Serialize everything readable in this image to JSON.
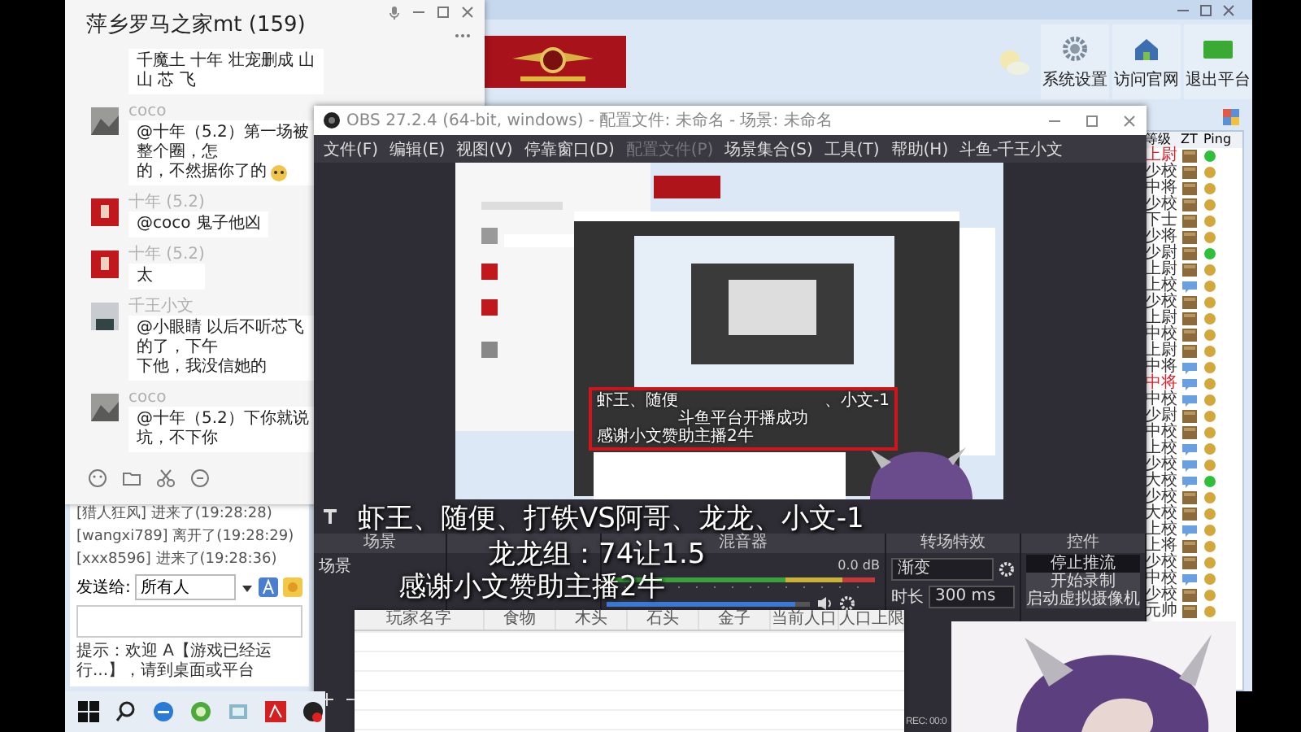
{
  "platform": {
    "toolbar": [
      {
        "kind": "gear",
        "label": "系统设置"
      },
      {
        "kind": "house",
        "label": "访问官网"
      },
      {
        "kind": "exit",
        "label": "退出平台"
      }
    ],
    "system_messages": [
      "[猎人狂风] 进来了(19:28:28)",
      "[wangxi789] 离开了(19:28:29)",
      "[xxx8596] 进来了(19:28:36)"
    ],
    "send_to": {
      "label": "发送给:",
      "value": "所有人"
    },
    "notice": "提示：欢迎 A【游戏已经运行...】，请到桌面或平台",
    "player_list": {
      "columns": [
        "等级",
        "ZT",
        "Ping"
      ],
      "rows": [
        {
          "rank": "上尉",
          "highlight": true,
          "kind": "box",
          "color": "#2fbf3a"
        },
        {
          "rank": "少校",
          "highlight": false,
          "kind": "box",
          "color": "#d4a73a"
        },
        {
          "rank": "中将",
          "highlight": false,
          "kind": "box",
          "color": "#d4a73a"
        },
        {
          "rank": "少校",
          "highlight": false,
          "kind": "box",
          "color": "#d4a73a"
        },
        {
          "rank": "下士",
          "highlight": false,
          "kind": "box",
          "color": "#d4a73a"
        },
        {
          "rank": "少将",
          "highlight": false,
          "kind": "box",
          "color": "#d4a73a"
        },
        {
          "rank": "少尉",
          "highlight": false,
          "kind": "box",
          "color": "#2fbf3a"
        },
        {
          "rank": "上尉",
          "highlight": false,
          "kind": "box",
          "color": "#d4a73a"
        },
        {
          "rank": "上校",
          "highlight": false,
          "kind": "chat",
          "color": "#d4a73a"
        },
        {
          "rank": "少校",
          "highlight": false,
          "kind": "box",
          "color": "#d4a73a"
        },
        {
          "rank": "上尉",
          "highlight": false,
          "kind": "box",
          "color": "#d4a73a"
        },
        {
          "rank": "中校",
          "highlight": false,
          "kind": "box",
          "color": "#d4a73a"
        },
        {
          "rank": "上尉",
          "highlight": false,
          "kind": "box",
          "color": "#d4a73a"
        },
        {
          "rank": "中将",
          "highlight": false,
          "kind": "chat",
          "color": "#d4a73a"
        },
        {
          "rank": "中将",
          "highlight": true,
          "kind": "chat",
          "color": "#d4a73a"
        },
        {
          "rank": "中校",
          "highlight": false,
          "kind": "chat",
          "color": "#d4a73a"
        },
        {
          "rank": "少尉",
          "highlight": false,
          "kind": "box",
          "color": "#d4a73a"
        },
        {
          "rank": "中校",
          "highlight": false,
          "kind": "box",
          "color": "#d4a73a"
        },
        {
          "rank": "上校",
          "highlight": false,
          "kind": "chat",
          "color": "#d4a73a"
        },
        {
          "rank": "少校",
          "highlight": false,
          "kind": "chat",
          "color": "#d4a73a"
        },
        {
          "rank": "大校",
          "highlight": false,
          "kind": "chat",
          "color": "#2fbf3a"
        },
        {
          "rank": "少校",
          "highlight": false,
          "kind": "box",
          "color": "#d4a73a"
        },
        {
          "rank": "大校",
          "highlight": false,
          "kind": "box",
          "color": "#d4a73a"
        },
        {
          "rank": "上校",
          "highlight": false,
          "kind": "chat",
          "color": "#d4a73a"
        },
        {
          "rank": "上将",
          "highlight": false,
          "kind": "box",
          "color": "#d4a73a"
        },
        {
          "rank": "少校",
          "highlight": false,
          "kind": "box",
          "color": "#d4a73a"
        },
        {
          "rank": "中校",
          "highlight": false,
          "kind": "chat",
          "color": "#d4a73a"
        },
        {
          "rank": "少校",
          "highlight": false,
          "kind": "box",
          "color": "#d4a73a"
        },
        {
          "rank": "元帅",
          "highlight": false,
          "kind": "box",
          "color": "#d4a73a"
        }
      ]
    }
  },
  "chat": {
    "title": "萍乡罗马之家mt (159)",
    "messages": [
      {
        "lines": [
          "千魔土 十年 壮宠删成 山山 芯 飞"
        ],
        "emoji": false
      },
      {
        "kind": "landscape",
        "sender": "coco",
        "lines": [
          "@十年（5.2）第一场被整个圈，怎",
          "的，不然据你了的"
        ],
        "emoji": true
      },
      {
        "kind": "red",
        "sender": "十年 (5.2)",
        "lines": [
          "@coco 鬼子他凶"
        ],
        "emoji": false
      },
      {
        "kind": "red",
        "sender": "十年 (5.2)",
        "lines": [
          "太"
        ],
        "emoji": false
      },
      {
        "kind": "person",
        "sender": "千王小文",
        "lines": [
          "@小眼睛 以后不听芯飞的了，下午",
          "下他，我没信她的"
        ],
        "emoji": false
      },
      {
        "kind": "landscape",
        "sender": "coco",
        "lines": [
          "@十年（5.2）下你就说坑，不下你"
        ],
        "emoji": false
      }
    ]
  },
  "obs": {
    "title": "OBS 27.2.4 (64-bit, windows) - 配置文件: 未命名 - 场景: 未命名",
    "menu": [
      {
        "label": "文件(F)",
        "disabled": false
      },
      {
        "label": "编辑(E)",
        "disabled": false
      },
      {
        "label": "视图(V)",
        "disabled": false
      },
      {
        "label": "停靠窗口(D)",
        "disabled": false
      },
      {
        "label": "配置文件(P)",
        "disabled": true
      },
      {
        "label": "场景集合(S)",
        "disabled": false
      },
      {
        "label": "工具(T)",
        "disabled": false
      },
      {
        "label": "帮助(H)",
        "disabled": false
      },
      {
        "label": "斗鱼-千王小文",
        "disabled": false
      }
    ],
    "capture_texts": [
      "虾王、随便",
      "、小文-1",
      "斗鱼平台开播成功",
      "感谢小文赞助主播2牛"
    ],
    "captions": [
      "虾王、随便、打铁VS阿哥、龙龙、小文-1",
      "龙龙组：74让1.5",
      "感谢小文赞助主播2牛"
    ],
    "scenes": {
      "title": "场景",
      "items": [
        "场景"
      ]
    },
    "mixer": {
      "title": "混音器",
      "reading": "0.0 dB",
      "level": 0.93
    },
    "transitions": {
      "title": "转场特效",
      "value": "渐变",
      "duration_label": "时长",
      "duration": "300 ms"
    },
    "controls": {
      "title": "控件",
      "buttons": [
        {
          "label": "停止推流",
          "active": true
        },
        {
          "label": "开始录制",
          "active": false
        },
        {
          "label": "启动虚拟摄像机",
          "active": false
        }
      ]
    },
    "status": "REC: 00:0"
  },
  "game_table": {
    "columns": [
      "玩家名字",
      "食物",
      "木头",
      "石头",
      "金子",
      "当前人口",
      "人口上限"
    ]
  },
  "taskbar": {
    "apps": [
      {
        "kind": "start"
      },
      {
        "kind": "search"
      },
      {
        "kind": "browser"
      },
      {
        "kind": "green"
      },
      {
        "kind": "files"
      },
      {
        "kind": "red"
      },
      {
        "kind": "obs"
      }
    ]
  }
}
